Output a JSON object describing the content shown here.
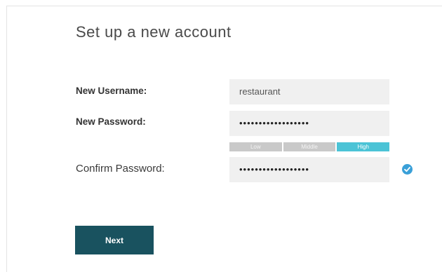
{
  "form": {
    "title": "Set up a new account",
    "username_label": "New Username:",
    "username_value": "restaurant",
    "password_label": "New Password:",
    "password_value": "••••••••••••••••••",
    "confirm_label": "Confirm Password:",
    "confirm_value": "••••••••••••••••••",
    "strength": {
      "levels": [
        "Low",
        "Middle",
        "High"
      ],
      "current": "High"
    },
    "confirm_status_icon": "check-circle-icon",
    "next_label": "Next"
  },
  "colors": {
    "accent": "#4bc3d6",
    "button": "#19525f",
    "check": "#3aa0d8"
  }
}
